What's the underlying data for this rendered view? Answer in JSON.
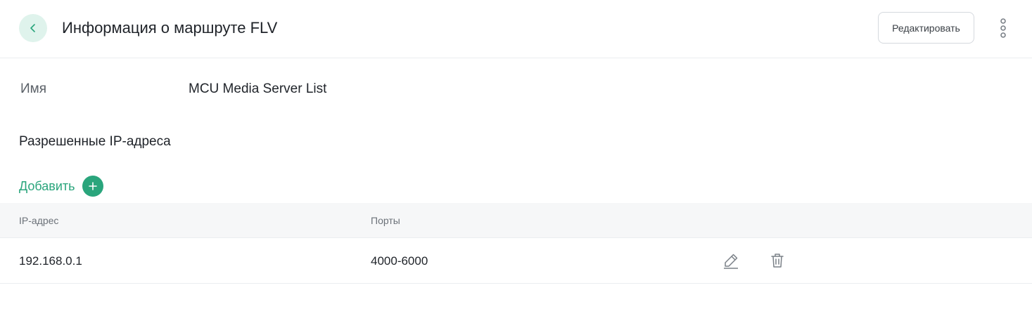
{
  "header": {
    "title": "Информация о маршруте FLV",
    "edit_label": "Редактировать",
    "back_icon": "chevron-left-icon",
    "more_icon": "more-vertical-icon"
  },
  "details": {
    "name_label": "Имя",
    "name_value": "MCU Media Server List"
  },
  "allowed_ips": {
    "section_title": "Разрешенные IP-адреса",
    "add_label": "Добавить",
    "add_icon": "plus-icon",
    "columns": [
      "IP-адрес",
      "Порты"
    ],
    "rows": [
      {
        "ip": "192.168.0.1",
        "ports": "4000-6000"
      }
    ],
    "row_action_icons": [
      "edit-pencil-icon",
      "trash-icon"
    ]
  },
  "colors": {
    "accent": "#2aa57c",
    "accent_light": "#dff3ec",
    "table_header_bg": "#f6f7f8",
    "divider": "#ebedf0"
  }
}
